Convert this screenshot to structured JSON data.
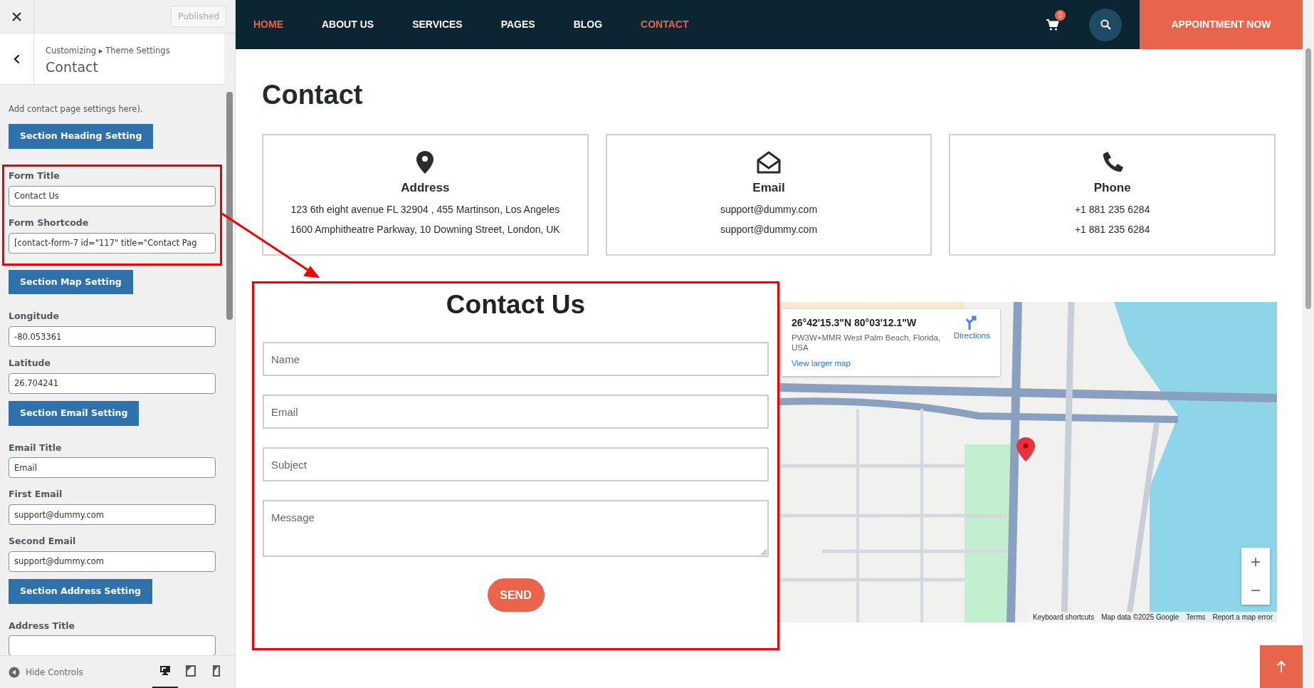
{
  "customizer": {
    "publish_button": "Published",
    "breadcrumb": "Customizing ▸ Theme Settings",
    "section_title": "Contact",
    "description": "Add contact page settings here).",
    "controls": [
      {
        "kind": "section_button",
        "label": "Section Heading Setting"
      },
      {
        "kind": "group",
        "highlighted": true,
        "children": [
          {
            "kind": "field",
            "label": "Form Title",
            "value": "Contact Us"
          },
          {
            "kind": "field",
            "label": "Form Shortcode",
            "value": "[contact-form-7 id=\"117\" title=\"Contact Pag"
          }
        ]
      },
      {
        "kind": "section_button",
        "label": "Section Map Setting"
      },
      {
        "kind": "field",
        "label": "Longitude",
        "value": "-80.053361"
      },
      {
        "kind": "field",
        "label": "Latitude",
        "value": "26.704241"
      },
      {
        "kind": "section_button",
        "label": "Section Email Setting"
      },
      {
        "kind": "field",
        "label": "Email Title",
        "value": "Email"
      },
      {
        "kind": "field",
        "label": "First Email",
        "value": "support@dummy.com"
      },
      {
        "kind": "field",
        "label": "Second Email",
        "value": "support@dummy.com"
      },
      {
        "kind": "section_button",
        "label": "Section Address Setting"
      },
      {
        "kind": "field",
        "label": "Address Title"
      }
    ],
    "hide_controls": "Hide Controls",
    "devices": [
      {
        "kind": "desktop",
        "selected": true
      },
      {
        "kind": "tablet",
        "selected": false
      },
      {
        "kind": "mobile",
        "selected": false
      }
    ]
  },
  "site": {
    "nav": [
      {
        "label": "HOME",
        "highlighted": true
      },
      {
        "label": "ABOUT US",
        "highlighted": false
      },
      {
        "label": "SERVICES",
        "highlighted": false
      },
      {
        "label": "PAGES",
        "highlighted": false
      },
      {
        "label": "BLOG",
        "highlighted": false
      },
      {
        "label": "CONTACT",
        "highlighted": true
      }
    ],
    "cart_count": "0",
    "appointment_button": "APPOINTMENT NOW",
    "page_title": "Contact",
    "cards": [
      {
        "kind": "address",
        "title": "Address",
        "lines": [
          "123 6th eight avenue FL 32904 , 455 Martinson, Los Angeles",
          "1600 Amphitheatre Parkway, 10 Downing Street, London, UK"
        ]
      },
      {
        "kind": "email",
        "title": "Email",
        "lines": [
          "support@dummy.com",
          "support@dummy.com"
        ]
      },
      {
        "kind": "phone",
        "title": "Phone",
        "lines": [
          "+1 881 235 6284",
          "+1 881 235 6284"
        ]
      }
    ],
    "form": {
      "highlighted": true,
      "title": "Contact Us",
      "fields": [
        {
          "kind": "input",
          "placeholder": "Name"
        },
        {
          "kind": "input",
          "placeholder": "Email"
        },
        {
          "kind": "input",
          "placeholder": "Subject"
        },
        {
          "kind": "textarea",
          "placeholder": "Message"
        }
      ],
      "submit": "SEND"
    },
    "map": {
      "kind": "picture",
      "info": {
        "coordinates": "26°42'15.3\"N 80°03'12.1\"W",
        "address": "PW3W+MMR West Palm Beach, Florida, USA",
        "directions": "Directions",
        "larger_map_link": "View larger map"
      },
      "zoom_in": "+",
      "zoom_out": "−",
      "attribution": [
        "Keyboard shortcuts",
        "Map data ©2025 Google",
        "Terms",
        "Report a map error"
      ]
    }
  },
  "annotated": true
}
